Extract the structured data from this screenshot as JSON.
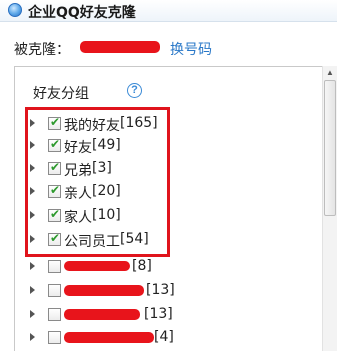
{
  "window": {
    "title": "企业QQ好友克隆"
  },
  "cloned": {
    "label": "被克隆：",
    "change_link": "换号码"
  },
  "section": {
    "title": "好友分组",
    "help": "?"
  },
  "groups": [
    {
      "label": "我的好友",
      "count": "[165]",
      "checked": true
    },
    {
      "label": "好友",
      "count": "[49]",
      "checked": true
    },
    {
      "label": "兄弟",
      "count": "[3]",
      "checked": true
    },
    {
      "label": "亲人",
      "count": "[20]",
      "checked": true
    },
    {
      "label": "家人",
      "count": "[10]",
      "checked": true
    },
    {
      "label": "公司员工",
      "count": "[54]",
      "checked": true
    },
    {
      "label": "",
      "count": "[8]",
      "checked": false
    },
    {
      "label": "",
      "count": "[13]",
      "checked": false
    },
    {
      "label": "",
      "count": "[13]",
      "checked": false
    },
    {
      "label": "",
      "count": "[4]",
      "checked": false
    }
  ],
  "colors": {
    "highlight": "#e0141c",
    "link": "#2a78c8",
    "redaction": "#e8141b"
  }
}
